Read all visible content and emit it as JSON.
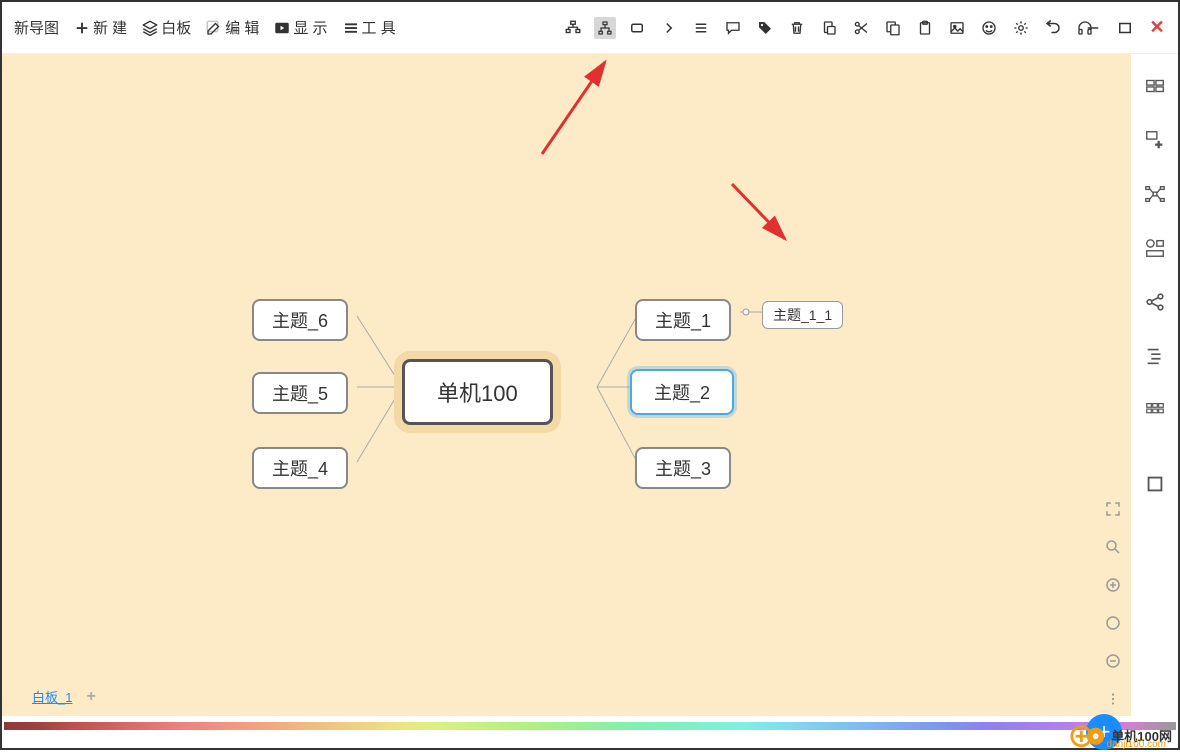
{
  "menubar": {
    "title": "新导图",
    "items": [
      {
        "label": "新 建",
        "icon": "plus"
      },
      {
        "label": "白板",
        "icon": "layers"
      },
      {
        "label": "编 辑",
        "icon": "edit"
      },
      {
        "label": "显 示",
        "icon": "play"
      },
      {
        "label": "工 具",
        "icon": "menu"
      }
    ]
  },
  "toolbar_center_icons": [
    "layout-h",
    "layout-v-active",
    "square",
    "chevron-right",
    "list",
    "chat",
    "tag",
    "trash",
    "paste-alt",
    "scissors",
    "copy",
    "clipboard",
    "image",
    "emoji",
    "gear",
    "undo",
    "headphones"
  ],
  "toolbar_right_icons": [
    "minimize",
    "maximize",
    "close"
  ],
  "mindmap": {
    "center": "单机100",
    "left_nodes": [
      "主题_6",
      "主题_5",
      "主题_4"
    ],
    "right_nodes": [
      "主题_1",
      "主题_2",
      "主题_3"
    ],
    "selected_right_index": 1,
    "sub_nodes": [
      {
        "parent": "主题_1",
        "label": "主题_1_1"
      }
    ]
  },
  "sidebar_icons": [
    "layout-grid",
    "plus-box",
    "branch",
    "chart",
    "share",
    "outline",
    "tiles",
    "square-outline"
  ],
  "zoom_tools": [
    "fullscreen",
    "search",
    "plus-circle",
    "circle",
    "minus-circle",
    "dots"
  ],
  "tabs": {
    "active": "白板_1"
  },
  "watermark": {
    "title": "单机100网",
    "url": "danji100.com"
  }
}
